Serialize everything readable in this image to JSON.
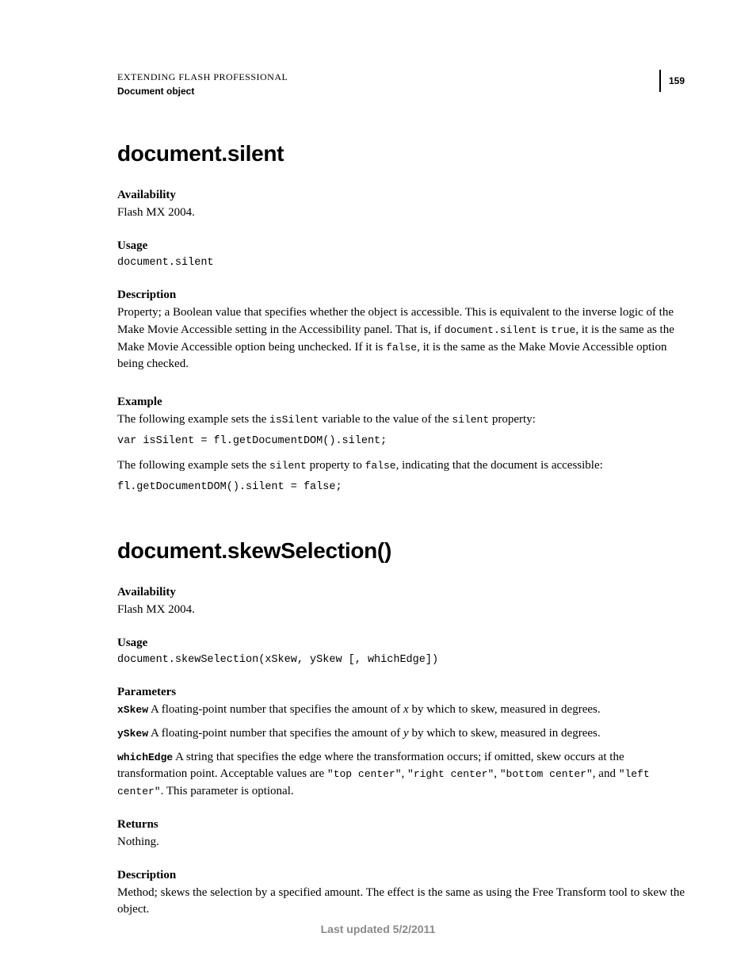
{
  "header": {
    "title": "EXTENDING FLASH PROFESSIONAL",
    "subtitle": "Document object",
    "page": "159"
  },
  "section1": {
    "heading": "document.silent",
    "availability_label": "Availability",
    "availability_text": "Flash MX 2004.",
    "usage_label": "Usage",
    "usage_code": "document.silent",
    "description_label": "Description",
    "description_text_1": "Property; a Boolean value that specifies whether the object is accessible. This is equivalent to the inverse logic of the Make Movie Accessible setting in the Accessibility panel. That is, if ",
    "description_code_1": "document.silent",
    "description_text_2": " is ",
    "description_code_2": "true",
    "description_text_3": ", it is the same as the Make Movie Accessible option being unchecked. If it is ",
    "description_code_3": "false",
    "description_text_4": ", it is the same as the Make Movie Accessible option being checked.",
    "example_label": "Example",
    "example_text_1a": "The following example sets the ",
    "example_code_1a": "isSilent",
    "example_text_1b": " variable to the value of the ",
    "example_code_1b": "silent",
    "example_text_1c": " property:",
    "example_code_line_1": "var isSilent = fl.getDocumentDOM().silent;",
    "example_text_2a": "The following example sets the ",
    "example_code_2a": "silent",
    "example_text_2b": " property to ",
    "example_code_2b": "false",
    "example_text_2c": ", indicating that the document is accessible:",
    "example_code_line_2": "fl.getDocumentDOM().silent = false;"
  },
  "section2": {
    "heading": "document.skewSelection()",
    "availability_label": "Availability",
    "availability_text": "Flash MX 2004.",
    "usage_label": "Usage",
    "usage_code": "document.skewSelection(xSkew, ySkew [, whichEdge])",
    "parameters_label": "Parameters",
    "param1_name": "xSkew",
    "param1_text_a": "  A floating-point number that specifies the amount of ",
    "param1_italic": "x",
    "param1_text_b": " by which to skew, measured in degrees.",
    "param2_name": "ySkew",
    "param2_text_a": "  A floating-point number that specifies the amount of ",
    "param2_italic": "y",
    "param2_text_b": " by which to skew, measured in degrees.",
    "param3_name": "whichEdge",
    "param3_text_a": "  A string that specifies the edge where the transformation occurs; if omitted, skew occurs at the transformation point. Acceptable values are ",
    "param3_code_1": "\"top center\"",
    "param3_sep_1": ", ",
    "param3_code_2": "\"right center\"",
    "param3_sep_2": ", ",
    "param3_code_3": "\"bottom center\"",
    "param3_sep_3": ", and ",
    "param3_code_4": "\"left center\"",
    "param3_text_b": ". This parameter is optional.",
    "returns_label": "Returns",
    "returns_text": "Nothing.",
    "description_label": "Description",
    "description_text": "Method; skews the selection by a specified amount. The effect is the same as using the Free Transform tool to skew the object."
  },
  "footer": "Last updated 5/2/2011"
}
